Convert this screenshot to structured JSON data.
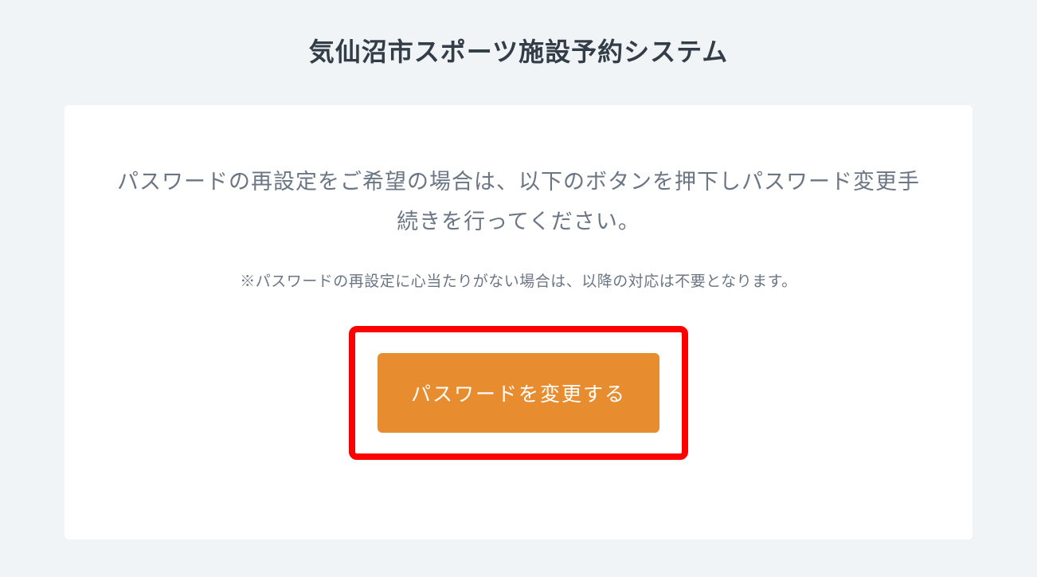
{
  "header": {
    "title": "気仙沼市スポーツ施設予約システム"
  },
  "card": {
    "instruction": "パスワードの再設定をご希望の場合は、以下のボタンを押下しパスワード変更手続きを行ってください。",
    "note": "※パスワードの再設定に心当たりがない場合は、以降の対応は不要となります。",
    "button_label": "パスワードを変更する"
  }
}
